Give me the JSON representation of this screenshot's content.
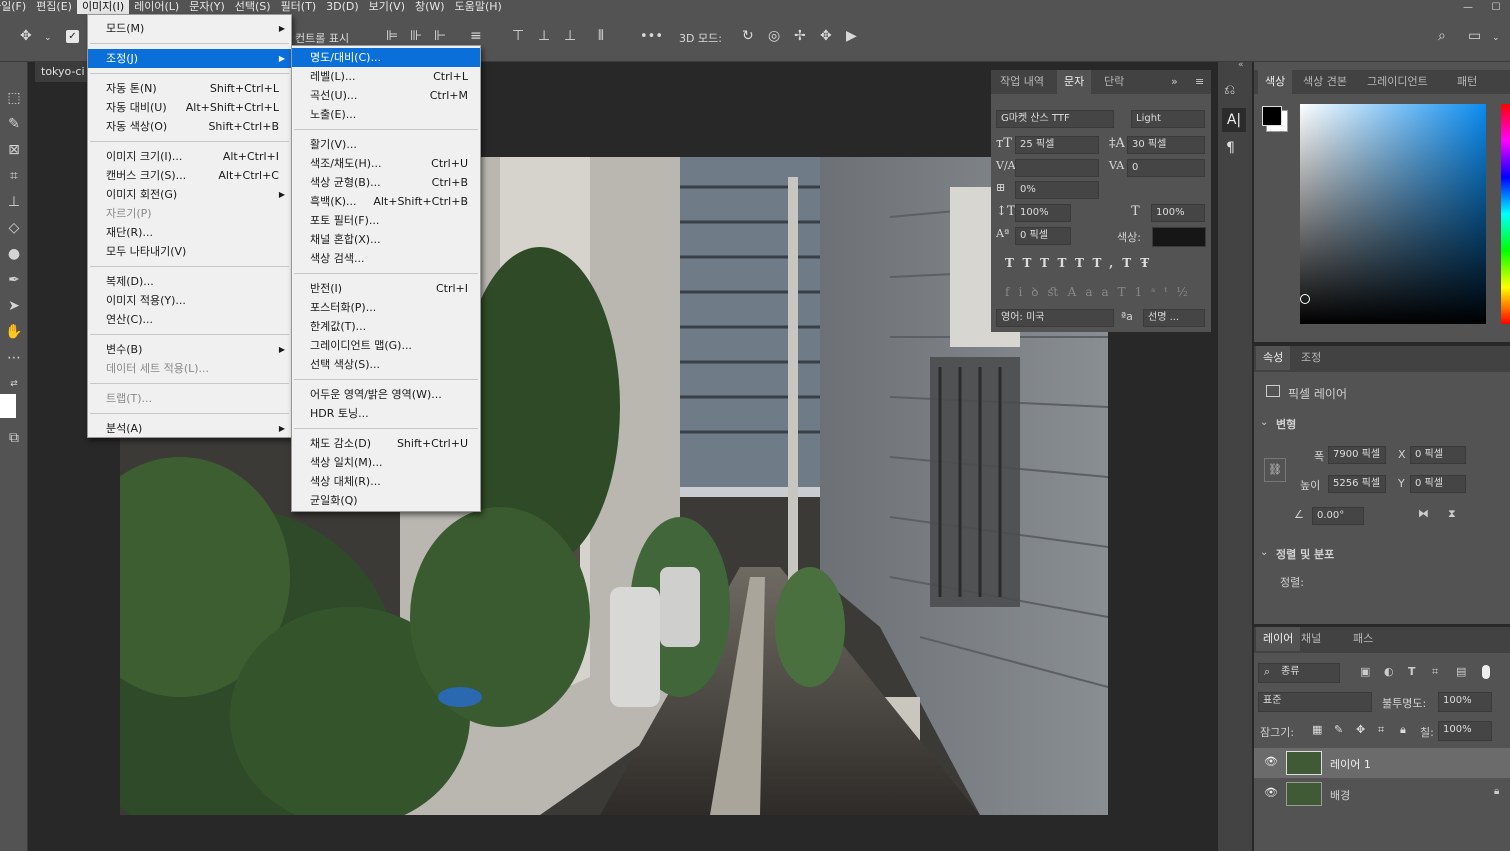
{
  "menubar": [
    "파일(F)",
    "편집(E)",
    "이미지(I)",
    "레이어(L)",
    "문자(Y)",
    "선택(S)",
    "필터(T)",
    "3D(D)",
    "보기(V)",
    "창(W)",
    "도움말(H)"
  ],
  "window_controls": [
    "—",
    "☐",
    "✕"
  ],
  "options_bar": {
    "show_transform_partial": "컨트롤 표시",
    "mode_3d": "3D 모드:",
    "more": "•••"
  },
  "document": {
    "tab_title": "tokyo-ci"
  },
  "image_menu": [
    {
      "label": "모드(M)",
      "shortcut": "",
      "submenu": true
    },
    {
      "sep": true
    },
    {
      "label": "조정(J)",
      "shortcut": "",
      "submenu": true,
      "highlight": true
    },
    {
      "sep": true
    },
    {
      "label": "자동 톤(N)",
      "shortcut": "Shift+Ctrl+L"
    },
    {
      "label": "자동 대비(U)",
      "shortcut": "Alt+Shift+Ctrl+L"
    },
    {
      "label": "자동 색상(O)",
      "shortcut": "Shift+Ctrl+B"
    },
    {
      "sep": true
    },
    {
      "label": "이미지 크기(I)...",
      "shortcut": "Alt+Ctrl+I"
    },
    {
      "label": "캔버스 크기(S)...",
      "shortcut": "Alt+Ctrl+C"
    },
    {
      "label": "이미지 회전(G)",
      "shortcut": "",
      "submenu": true
    },
    {
      "label": "자르기(P)",
      "shortcut": "",
      "disabled": true
    },
    {
      "label": "재단(R)...",
      "shortcut": ""
    },
    {
      "label": "모두 나타내기(V)",
      "shortcut": ""
    },
    {
      "sep": true
    },
    {
      "label": "복제(D)...",
      "shortcut": ""
    },
    {
      "label": "이미지 적용(Y)...",
      "shortcut": ""
    },
    {
      "label": "연산(C)...",
      "shortcut": ""
    },
    {
      "sep": true
    },
    {
      "label": "변수(B)",
      "shortcut": "",
      "submenu": true
    },
    {
      "label": "데이터 세트 적용(L)...",
      "shortcut": "",
      "disabled": true
    },
    {
      "sep": true
    },
    {
      "label": "트랩(T)...",
      "shortcut": "",
      "disabled": true
    },
    {
      "sep": true
    },
    {
      "label": "분석(A)",
      "shortcut": "",
      "submenu": true
    }
  ],
  "adjust_menu": [
    {
      "label": "명도/대비(C)...",
      "shortcut": "",
      "highlight": true
    },
    {
      "label": "레벨(L)...",
      "shortcut": "Ctrl+L"
    },
    {
      "label": "곡선(U)...",
      "shortcut": "Ctrl+M"
    },
    {
      "label": "노출(E)...",
      "shortcut": ""
    },
    {
      "sep": true
    },
    {
      "label": "활기(V)...",
      "shortcut": ""
    },
    {
      "label": "색조/채도(H)...",
      "shortcut": "Ctrl+U"
    },
    {
      "label": "색상 균형(B)...",
      "shortcut": "Ctrl+B"
    },
    {
      "label": "흑백(K)...",
      "shortcut": "Alt+Shift+Ctrl+B"
    },
    {
      "label": "포토 필터(F)...",
      "shortcut": ""
    },
    {
      "label": "채널 혼합(X)...",
      "shortcut": ""
    },
    {
      "label": "색상 검색...",
      "shortcut": ""
    },
    {
      "sep": true
    },
    {
      "label": "반전(I)",
      "shortcut": "Ctrl+I"
    },
    {
      "label": "포스터화(P)...",
      "shortcut": ""
    },
    {
      "label": "한계값(T)...",
      "shortcut": ""
    },
    {
      "label": "그레이디언트 맵(G)...",
      "shortcut": ""
    },
    {
      "label": "선택 색상(S)...",
      "shortcut": ""
    },
    {
      "sep": true
    },
    {
      "label": "어두운 영역/밝은 영역(W)...",
      "shortcut": ""
    },
    {
      "label": "HDR 토닝...",
      "shortcut": ""
    },
    {
      "sep": true
    },
    {
      "label": "채도 감소(D)",
      "shortcut": "Shift+Ctrl+U"
    },
    {
      "label": "색상 일치(M)...",
      "shortcut": ""
    },
    {
      "label": "색상 대체(R)...",
      "shortcut": ""
    },
    {
      "label": "균일화(Q)",
      "shortcut": ""
    }
  ],
  "char_panel": {
    "tabs": [
      "작업 내역",
      "문자",
      "단락"
    ],
    "font_family": "G마켓 산스 TTF",
    "font_style": "Light",
    "size": "25 픽셀",
    "leading": "30 픽셀",
    "kerning": "",
    "tracking": "0",
    "scale_pct": "0%",
    "vscale": "100%",
    "hscale": "100%",
    "baseline": "0 픽셀",
    "color_label": "색상:",
    "language": "영어: 미국",
    "aa_icon": "ªa",
    "antialias": "선명 ..."
  },
  "color_panel": {
    "tabs": [
      "색상",
      "색상 견본",
      "그레이디언트",
      "패턴"
    ]
  },
  "props_panel": {
    "tabs": [
      "속성",
      "조정"
    ],
    "layer_type": "픽셀 레이어",
    "transform_title": "변형",
    "w_label": "폭",
    "w_value": "7900 픽셀",
    "h_label": "높이",
    "h_value": "5256 픽셀",
    "x_label": "X",
    "x_value": "0 픽셀",
    "y_label": "Y",
    "y_value": "0 픽셀",
    "angle": "0.00°",
    "align_title": "정렬 및 분포",
    "align_label": "정렬:"
  },
  "layers_panel": {
    "tabs": [
      "레이어",
      "채널",
      "패스"
    ],
    "filter_kind": "종류",
    "blend_mode": "표준",
    "opacity_label": "불투명도:",
    "opacity": "100%",
    "lock_label": "잠그기:",
    "fill_label": "칠:",
    "fill": "100%",
    "layers": [
      {
        "name": "레이어 1",
        "selected": true,
        "locked": false
      },
      {
        "name": "배경",
        "selected": false,
        "locked": true
      }
    ]
  },
  "colors": {
    "accent": "#0a6fd8",
    "panel": "#535353"
  }
}
